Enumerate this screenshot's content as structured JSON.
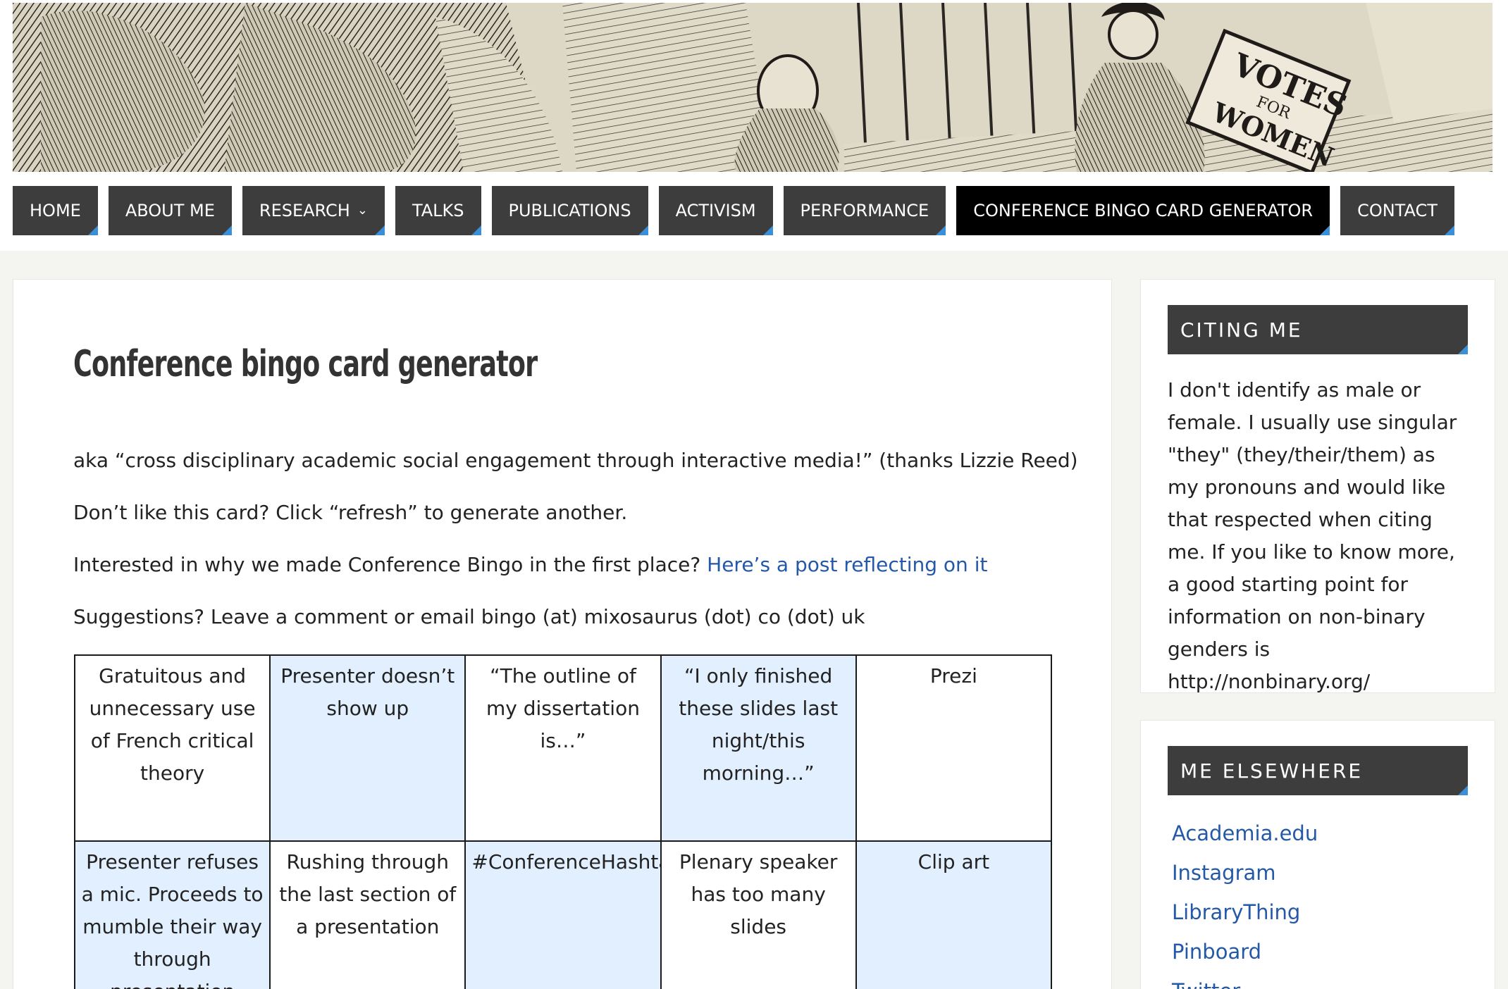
{
  "banner": {
    "caption": "VOTES FOR WOMEN"
  },
  "nav": {
    "items": [
      {
        "label": "HOME"
      },
      {
        "label": "ABOUT ME"
      },
      {
        "label": "RESEARCH"
      },
      {
        "label": "TALKS"
      },
      {
        "label": "PUBLICATIONS"
      },
      {
        "label": "ACTIVISM"
      },
      {
        "label": "PERFORMANCE"
      },
      {
        "label": "CONFERENCE BINGO CARD GENERATOR"
      },
      {
        "label": "CONTACT"
      }
    ],
    "active_index": 7,
    "dropdown_icon": "chevron-down-icon",
    "accent_color": "#3b8fd8"
  },
  "main": {
    "title": "Conference bingo card generator",
    "para1": "aka “cross disciplinary academic social engagement through interactive media!” (thanks Lizzie Reed)",
    "para2": "Don’t like this card? Click “refresh” to generate another.",
    "para3_text": "Interested in why we made Conference Bingo in the first place?",
    "para3_link": "Here’s a post reflecting on it",
    "para4": "Suggestions? Leave a comment or email bingo (at) mixosaurus (dot) co (dot) uk",
    "bingo": {
      "rows": [
        [
          "Gratuitous and unnecessary use of French critical theory",
          "Presenter doesn’t show up",
          "“The outline of my dissertation is…”",
          "“I only finished these slides last night/this morning…”",
          "Prezi"
        ],
        [
          "Presenter refuses a mic. Proceeds to mumble their way through presentation",
          "Rushing through the last section of a presentation",
          "#ConferenceHashtag",
          "Plenary speaker has too many slides",
          "Clip art"
        ]
      ],
      "highlight_color": "#e2efff"
    }
  },
  "sidebar": {
    "citing": {
      "title": "CITING ME",
      "text": "I don't identify as male or female. I usually use singular \"they\" (they/their/them) as my pronouns and would like that respected when citing me. If you like to know more, a good starting point for information on non-binary genders is http://nonbinary.org/"
    },
    "elsewhere": {
      "title": "ME ELSEWHERE",
      "links": [
        "Academia.edu",
        "Instagram",
        "LibraryThing",
        "Pinboard",
        "Twitter"
      ]
    }
  }
}
